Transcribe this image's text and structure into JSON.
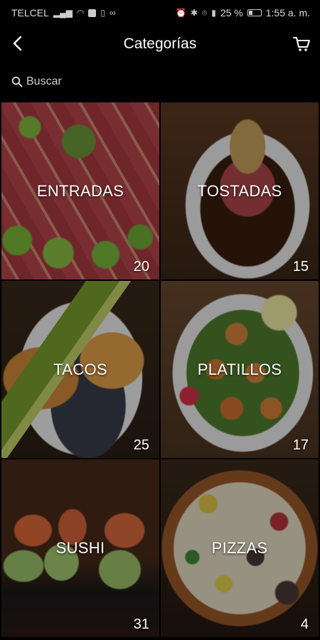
{
  "status_bar": {
    "carrier": "TELCEL",
    "battery": "25 %",
    "time": "1:55 a. m."
  },
  "header": {
    "title": "Categorías",
    "back_icon": "chevron-left-icon",
    "cart_icon": "cart-icon"
  },
  "search": {
    "placeholder": "Buscar",
    "icon": "search-icon"
  },
  "categories": [
    {
      "name": "ENTRADAS",
      "count": "20"
    },
    {
      "name": "TOSTADAS",
      "count": "15"
    },
    {
      "name": "TACOS",
      "count": "25"
    },
    {
      "name": "PLATILLOS",
      "count": "17"
    },
    {
      "name": "SUSHI",
      "count": "31"
    },
    {
      "name": "PIZZAS",
      "count": "4"
    }
  ]
}
